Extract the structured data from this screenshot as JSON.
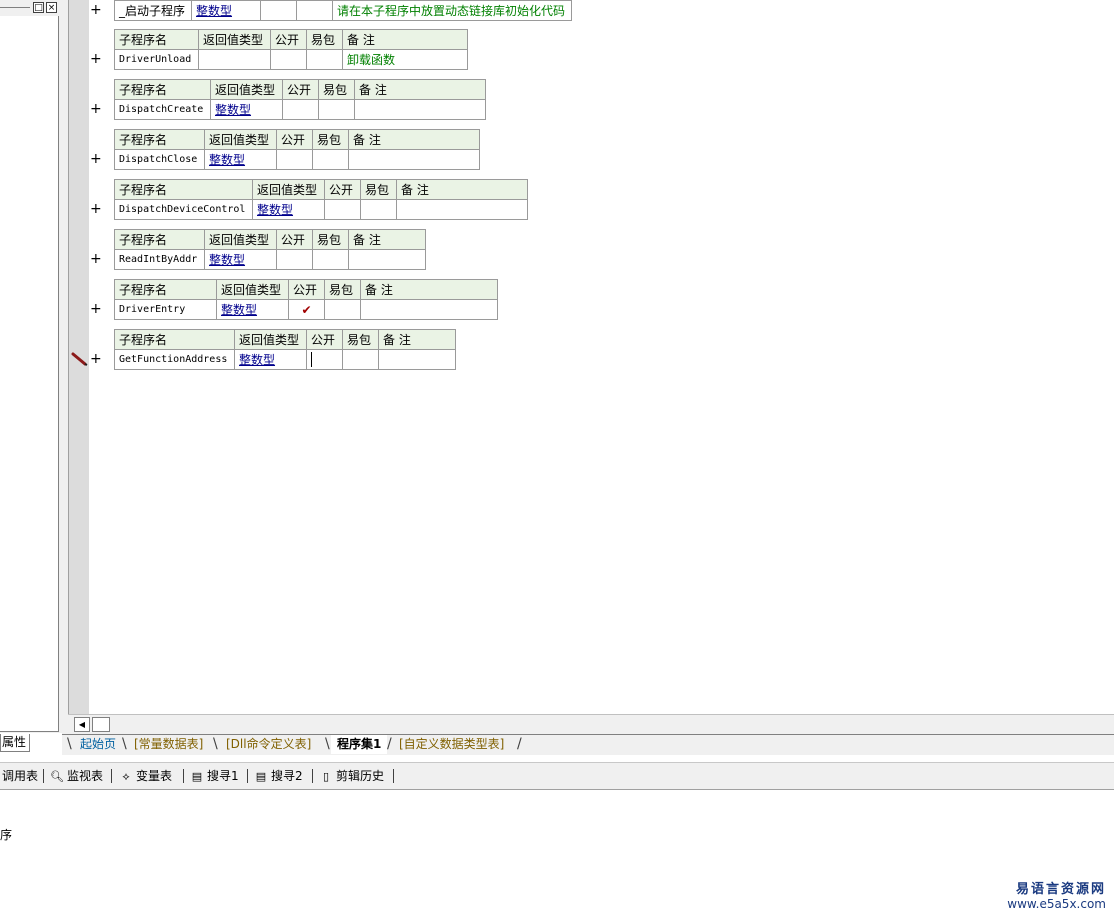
{
  "left_panel": {
    "tab_label": "属性"
  },
  "tables": [
    {
      "plus": "+",
      "row": {
        "name": "_启动子程序",
        "return_type": "整数型",
        "public": "",
        "easy_pack": "",
        "note": "请在本子程序中放置动态链接库初始化代码"
      }
    },
    {
      "plus": "+",
      "header": {
        "name": "子程序名",
        "return_type": "返回值类型",
        "public": "公开",
        "easy_pack": "易包",
        "note": "备 注"
      },
      "row": {
        "name": "DriverUnload",
        "return_type": "",
        "public": "",
        "easy_pack": "",
        "note": "卸载函数"
      }
    },
    {
      "plus": "+",
      "header": {
        "name": "子程序名",
        "return_type": "返回值类型",
        "public": "公开",
        "easy_pack": "易包",
        "note": "备 注"
      },
      "row": {
        "name": "DispatchCreate",
        "return_type": "整数型",
        "public": "",
        "easy_pack": "",
        "note": ""
      }
    },
    {
      "plus": "+",
      "header": {
        "name": "子程序名",
        "return_type": "返回值类型",
        "public": "公开",
        "easy_pack": "易包",
        "note": "备 注"
      },
      "row": {
        "name": "DispatchClose",
        "return_type": "整数型",
        "public": "",
        "easy_pack": "",
        "note": ""
      }
    },
    {
      "plus": "+",
      "header": {
        "name": "子程序名",
        "return_type": "返回值类型",
        "public": "公开",
        "easy_pack": "易包",
        "note": "备 注"
      },
      "row": {
        "name": "DispatchDeviceControl",
        "return_type": "整数型",
        "public": "",
        "easy_pack": "",
        "note": ""
      }
    },
    {
      "plus": "+",
      "header": {
        "name": "子程序名",
        "return_type": "返回值类型",
        "public": "公开",
        "easy_pack": "易包",
        "note": "备 注"
      },
      "row": {
        "name": "ReadIntByAddr",
        "return_type": "整数型",
        "public": "",
        "easy_pack": "",
        "note": ""
      }
    },
    {
      "plus": "+",
      "header": {
        "name": "子程序名",
        "return_type": "返回值类型",
        "public": "公开",
        "easy_pack": "易包",
        "note": "备 注"
      },
      "row": {
        "name": "DriverEntry",
        "return_type": "整数型",
        "public": "✔",
        "easy_pack": "",
        "note": ""
      }
    },
    {
      "plus": "+",
      "header": {
        "name": "子程序名",
        "return_type": "返回值类型",
        "public": "公开",
        "easy_pack": "易包",
        "note": "备 注"
      },
      "row": {
        "name": "GetFunctionAddress",
        "return_type": "整数型",
        "public": "",
        "easy_pack": "",
        "note": ""
      }
    }
  ],
  "tabs": [
    {
      "label": "起始页"
    },
    {
      "label": "[常量数据表]"
    },
    {
      "label": "[Dll命令定义表]"
    },
    {
      "label": "程序集1"
    },
    {
      "label": "[自定义数据类型表]"
    }
  ],
  "tools": [
    {
      "label": "调用表",
      "icon": "list-icon"
    },
    {
      "label": "监视表",
      "icon": "magnifier-icon"
    },
    {
      "label": "变量表",
      "icon": "variables-icon"
    },
    {
      "label": "搜寻1",
      "icon": "search-doc-icon"
    },
    {
      "label": "搜寻2",
      "icon": "search-doc-icon"
    },
    {
      "label": "剪辑历史",
      "icon": "clipboard-icon"
    }
  ],
  "bottom_pane": {
    "text": "序"
  },
  "brand": {
    "name": "易语言资源网",
    "url": "www.e5a5x.com"
  }
}
